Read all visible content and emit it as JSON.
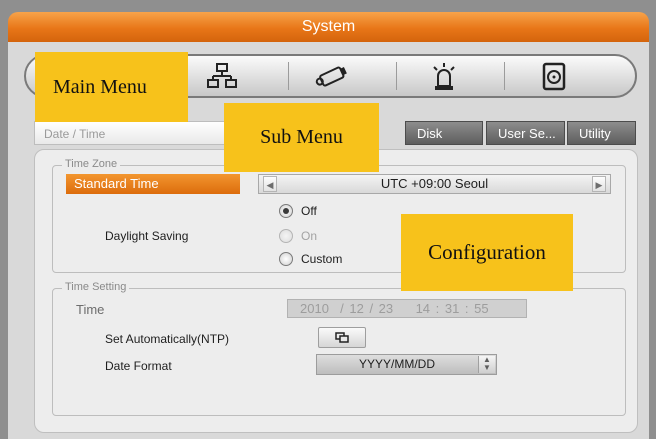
{
  "window": {
    "title": "System"
  },
  "main_menu": {
    "icons": [
      "network-icon",
      "camera-icon",
      "alarm-icon",
      "storage-disk-icon"
    ]
  },
  "sub_menu": {
    "tabs": [
      {
        "label": "Date / Time",
        "active": true
      },
      {
        "label": "Disk",
        "active": false
      },
      {
        "label": "User Se...",
        "active": false
      },
      {
        "label": "Utility",
        "active": false
      }
    ]
  },
  "time_zone": {
    "group_title": "Time Zone",
    "standard_time_label": "Standard Time",
    "value": "UTC +09:00 Seoul"
  },
  "daylight_saving": {
    "label": "Daylight Saving",
    "options": [
      {
        "label": "Off",
        "selected": true,
        "disabled": false
      },
      {
        "label": "On",
        "selected": false,
        "disabled": true
      },
      {
        "label": "Custom",
        "selected": false,
        "disabled": false
      }
    ]
  },
  "time_setting": {
    "group_title": "Time Setting",
    "time_label": "Time",
    "time_value": "2010  / 12 / 23    14 : 31 : 55",
    "ntp_label": "Set Automatically(NTP)",
    "date_format_label": "Date Format",
    "date_format_value": "YYYY/MM/DD"
  },
  "callouts": {
    "main_menu": "Main Menu",
    "sub_menu": "Sub Menu",
    "configuration": "Configuration"
  },
  "colors": {
    "accent": "#e87618",
    "callout": "#f7c21b"
  }
}
